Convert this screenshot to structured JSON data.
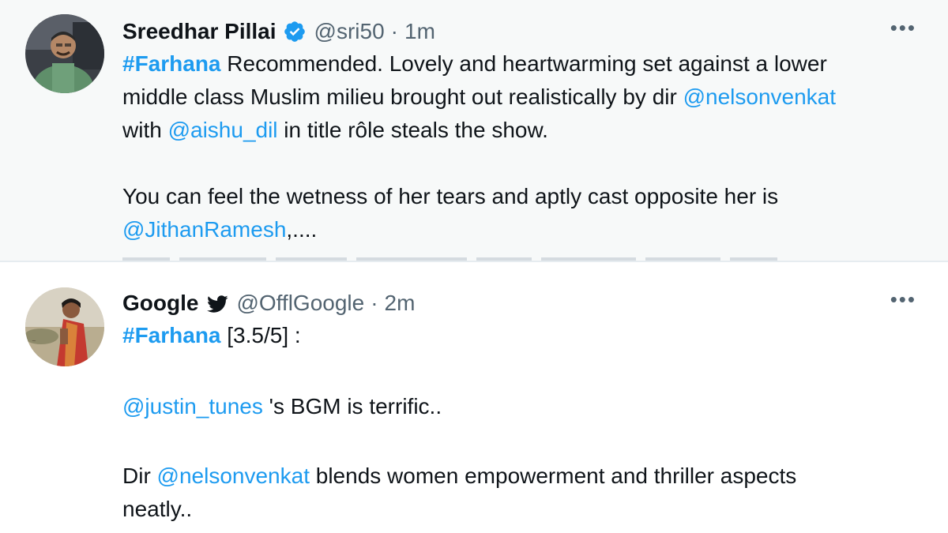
{
  "tweets": [
    {
      "name": "Sreedhar Pillai",
      "handle": "@sri50",
      "dot": "·",
      "time": "1m",
      "more": "•••",
      "hashtag": "#Farhana",
      "text_1a": " Recommended. Lovely and heartwarming set against a lower",
      "text_2a": "middle class Muslim milieu brought out realistically by dir ",
      "mention_2": "@nelsonvenkat",
      "text_3a": "with ",
      "mention_3": "@aishu_dil",
      "text_3b": " in title rôle steals the show.",
      "text_5": "You can feel the wetness of her tears and aptly cast opposite her is",
      "mention_6": "@JithanRamesh",
      "text_6b": ",...."
    },
    {
      "name": "Google",
      "handle": "@OfflGoogle",
      "dot": "·",
      "time": "2m",
      "more": "•••",
      "hashtag": "#Farhana",
      "text_1b": " [3.5/5] :",
      "mention_3": "@justin_tunes",
      "text_3b": " 's BGM is terrific..",
      "text_5a": "Dir ",
      "mention_5": "@nelsonvenkat",
      "text_5b": " blends women empowerment and thriller aspects",
      "text_6": "neatly.."
    }
  ],
  "colors": {
    "link": "#1d9bf0",
    "secondary": "#536471",
    "text": "#0f1419",
    "highlight_bg": "#f7f9f9"
  },
  "icons": {
    "verified": "verified-badge-icon",
    "bird": "twitter-bird-icon",
    "more": "more-options-icon"
  }
}
